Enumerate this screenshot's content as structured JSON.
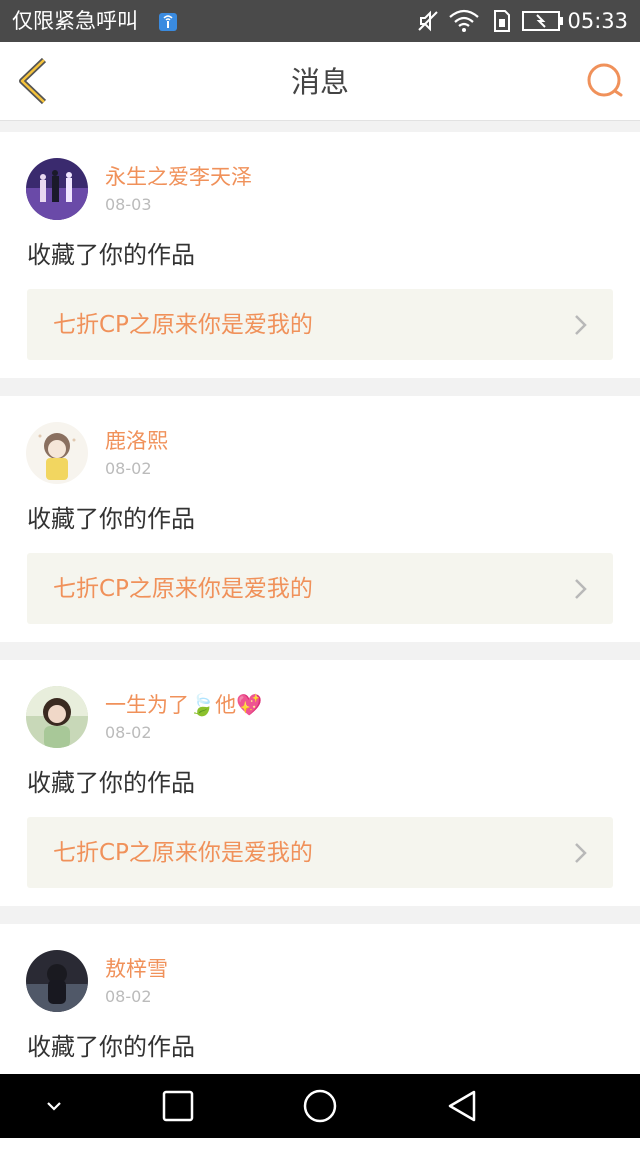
{
  "status_bar": {
    "carrier": "仅限紧急呼叫",
    "time": "05:33"
  },
  "header": {
    "title": "消息"
  },
  "colors": {
    "accent": "#f0915a",
    "header_bg": "#ffffff",
    "link_bg": "#f5f5ee"
  },
  "messages": [
    {
      "username": "永生之爱李天泽",
      "date": "08-03",
      "action": "收藏了你的作品",
      "work_title": "七折CP之原来你是爱我的"
    },
    {
      "username": "鹿洛熙",
      "date": "08-02",
      "action": "收藏了你的作品",
      "work_title": "七折CP之原来你是爱我的"
    },
    {
      "username": "一生为了🍃他💖",
      "date": "08-02",
      "action": "收藏了你的作品",
      "work_title": "七折CP之原来你是爱我的"
    },
    {
      "username": "敖梓雪",
      "date": "08-02",
      "action": "收藏了你的作品",
      "work_title": ""
    }
  ],
  "nav_bar": {
    "icons": [
      "chevron-down-icon",
      "recents-square-icon",
      "home-circle-icon",
      "back-triangle-icon"
    ]
  }
}
